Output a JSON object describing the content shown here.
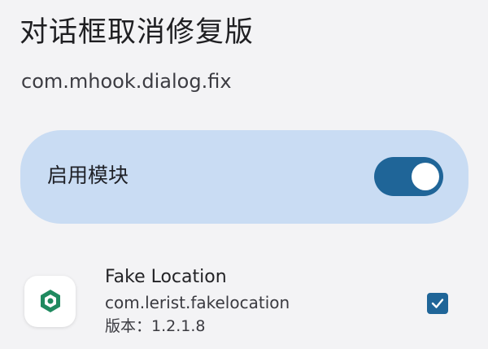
{
  "header": {
    "title": "对话框取消修复版",
    "package": "com.mhook.dialog.fix"
  },
  "module_switch": {
    "label": "启用模块",
    "enabled": true
  },
  "apps": [
    {
      "name": "Fake Location",
      "package": "com.lerist.fakelocation",
      "version": "版本：1.2.1.8",
      "checked": true,
      "icon": "location-hexagon-icon"
    }
  ],
  "colors": {
    "background": "#f3f3f5",
    "card": "#c9dcf3",
    "accent": "#1f6598",
    "icon_green": "#1f8a5f"
  }
}
